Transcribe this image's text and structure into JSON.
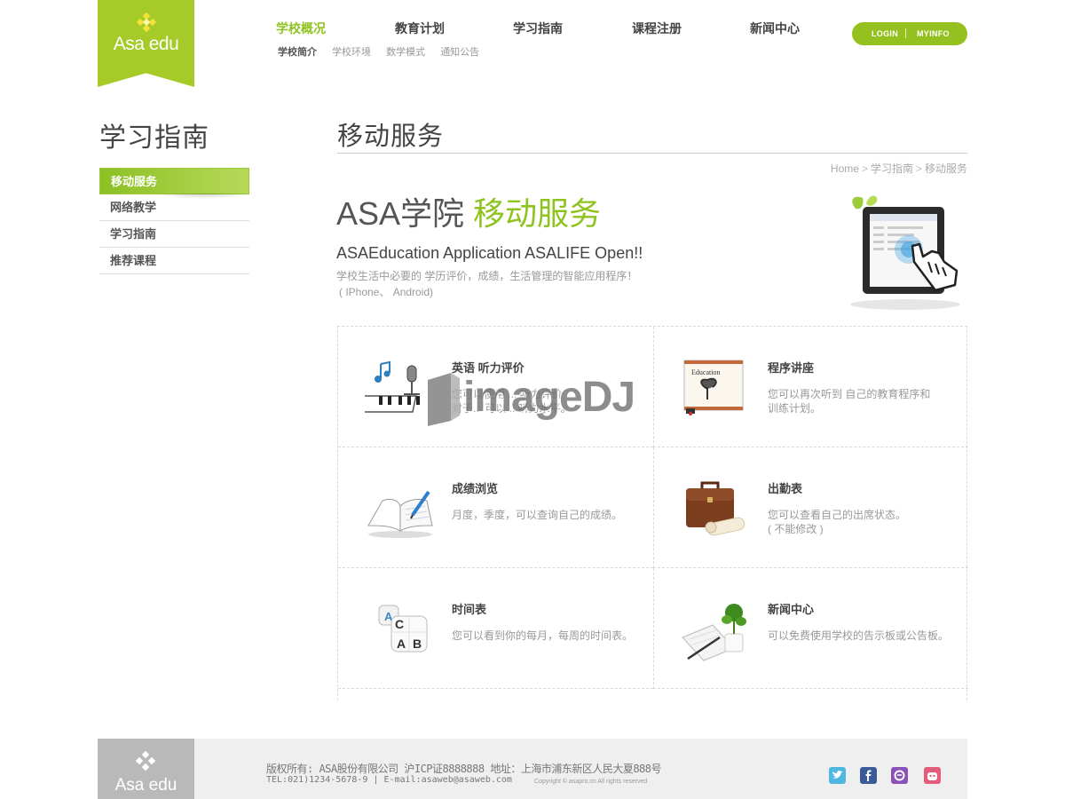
{
  "header": {
    "logo_text": "Asa edu",
    "nav": [
      "学校概况",
      "教育计划",
      "学习指南",
      "课程注册",
      "新闻中心"
    ],
    "subnav": [
      "学校简介",
      "学校环境",
      "数学模式",
      "通知公告"
    ],
    "login": "LOGIN",
    "myinfo": "MYINFO"
  },
  "sidebar": {
    "title": "学习指南",
    "items": [
      "移动服务",
      "网络教学",
      "学习指南",
      "推荐课程"
    ]
  },
  "content": {
    "title": "移动服务",
    "breadcrumb": [
      "Home",
      "学习指南",
      "移动服务"
    ],
    "hero_title_a": "ASA学院",
    "hero_title_b": "移动服务",
    "hero_subtitle": "ASAEducation Application ASALIFE Open!!",
    "hero_desc_1": "学校生活中必要的 学历评价，成绩，生活管理的智能应用程序！",
    "hero_desc_2": "( IPhone、 Android)"
  },
  "features": [
    {
      "title": "英语 听力评价",
      "desc": "您可以使用 ... 听力评价 \n 对于... 可以... 听力水平。",
      "icon": "music-icon"
    },
    {
      "title": "程序讲座",
      "desc": "您可以再次听到 自己的教育程序和\n训练计划。",
      "icon": "education-board-icon"
    },
    {
      "title": "成绩浏览",
      "desc": "月度，季度，可以查询自己的成绩。",
      "icon": "book-icon"
    },
    {
      "title": "出勤表",
      "desc": "您可以查看自己的出席状态。\n( 不能修改 )",
      "icon": "briefcase-icon"
    },
    {
      "title": "时间表",
      "desc": "您可以看到你的每月，每周的时间表。",
      "icon": "dice-icon"
    },
    {
      "title": "新闻中心",
      "desc": "可以免费使用学校的告示板或公告板。",
      "icon": "plant-icon"
    }
  ],
  "watermark": "imageDJ",
  "footer": {
    "logo_text": "Asa edu",
    "copyright": "版权所有: ASA股份有限公司 沪ICP证8888888 地址：上海市浦东新区人民大夏888号",
    "contact": "TEL:021)1234-5678-9 | E-mail:asaweb@asaweb.com",
    "rights": "Copyright © asapro.cn All rights reserved",
    "social": [
      "twitter-icon",
      "facebook-icon",
      "blog-icon",
      "me2day-icon"
    ]
  },
  "colors": {
    "accent": "#8fc31f",
    "logo_bg": "#a6ca28",
    "footer_logo_bg": "#b9b9b9"
  }
}
